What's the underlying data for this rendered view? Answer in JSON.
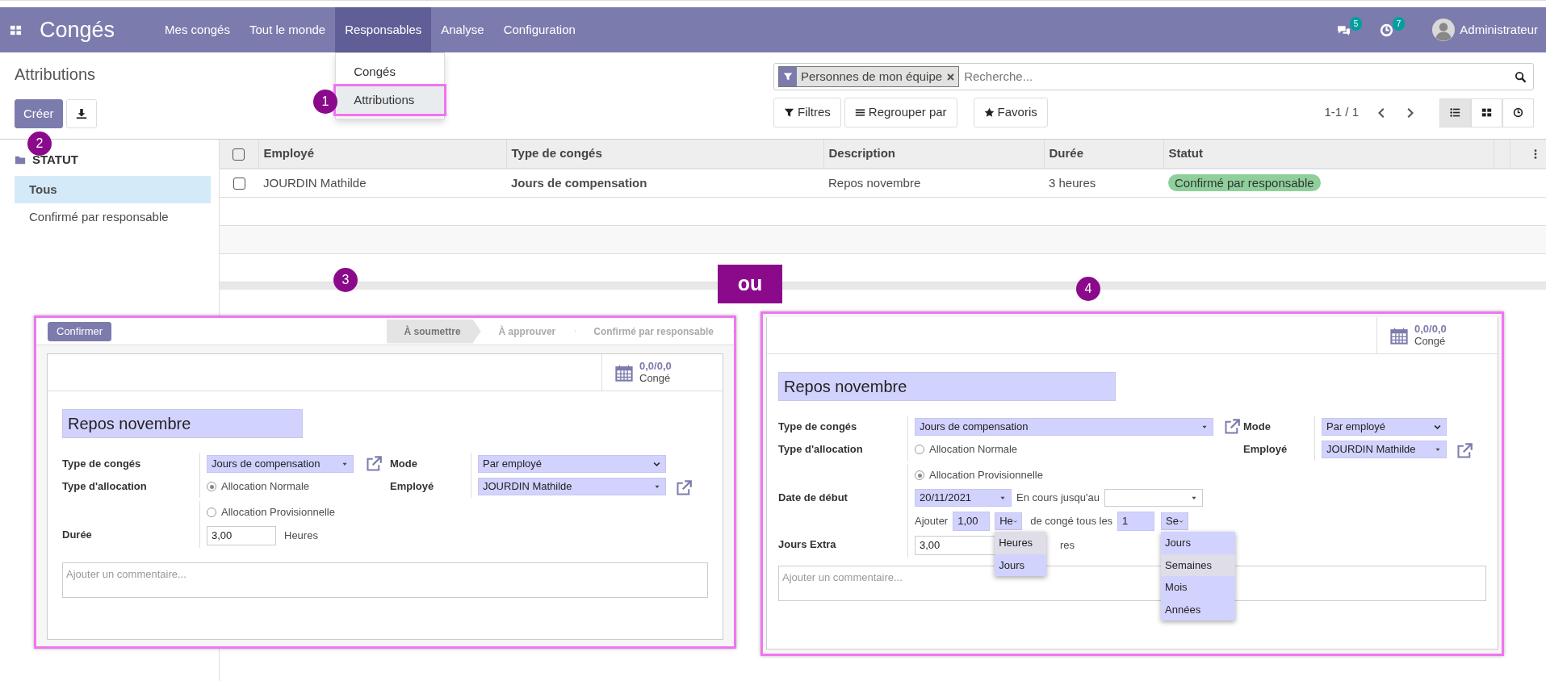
{
  "app": {
    "title": "Congés"
  },
  "menu": [
    {
      "label": "Mes congés",
      "selected": false
    },
    {
      "label": "Tout le monde",
      "selected": false
    },
    {
      "label": "Responsables",
      "selected": true
    },
    {
      "label": "Analyse",
      "selected": false
    },
    {
      "label": "Configuration",
      "selected": false
    }
  ],
  "menu_dropdown": [
    {
      "label": "Congés",
      "selected": false
    },
    {
      "label": "Attributions",
      "selected": true
    }
  ],
  "systray": {
    "messages_count": "5",
    "activities_count": "7",
    "user": "Administrateur"
  },
  "breadcrumb": "Attributions",
  "create_button": "Créer",
  "search": {
    "facet": "Personnes de mon équipe",
    "placeholder": "Recherche..."
  },
  "search_buttons": [
    {
      "kind": "filter",
      "label": "Filtres"
    },
    {
      "kind": "group",
      "label": "Regrouper par"
    },
    {
      "kind": "favorite",
      "label": "Favoris"
    }
  ],
  "pager": "1-1 / 1",
  "views": [
    {
      "kind": "list",
      "selected": true
    },
    {
      "kind": "kanban",
      "selected": false
    },
    {
      "kind": "activity",
      "selected": false
    }
  ],
  "sidebar": {
    "title": "STATUT",
    "items": [
      {
        "label": "Tous",
        "selected": true
      },
      {
        "label": "Confirmé par responsable",
        "selected": false
      }
    ]
  },
  "table": {
    "all_checked": false,
    "columns": [
      "Employé",
      "Type de congés",
      "Description",
      "Durée",
      "Statut"
    ],
    "rows": [
      {
        "checked": false,
        "employee": "JOURDIN Mathilde",
        "leave_type": "Jours de compensation",
        "description": "Repos novembre",
        "duration": "3 heures",
        "status": "Confirmé par responsable"
      }
    ]
  },
  "callouts": [
    "1",
    "2",
    "3",
    "4"
  ],
  "separator": "ou",
  "form_a": {
    "confirm_button": "Confirmer",
    "stages": [
      {
        "label": "À soumettre",
        "selected": true
      },
      {
        "label": "À approuver",
        "selected": false
      },
      {
        "label": "Confirmé par responsable",
        "selected": false
      }
    ],
    "stat": {
      "value": "0,0/0,0",
      "label": "Congé"
    },
    "name": "Repos novembre",
    "leave_type": {
      "label": "Type de congés",
      "value": "Jours de compensation"
    },
    "allocation_type": {
      "label": "Type d'allocation",
      "options": [
        {
          "label": "Allocation Normale",
          "selected": true
        },
        {
          "label": "Allocation Provisionnelle",
          "selected": false
        }
      ]
    },
    "duration": {
      "label": "Durée",
      "value": "3,00",
      "unit": "Heures"
    },
    "mode": {
      "label": "Mode",
      "value": "Par employé"
    },
    "employee": {
      "label": "Employé",
      "value": "JOURDIN Mathilde"
    },
    "comment": {
      "placeholder": "Ajouter un commentaire..."
    }
  },
  "form_b": {
    "stat": {
      "value": "0,0/0,0",
      "label": "Congé"
    },
    "name": "Repos novembre",
    "leave_type": {
      "label": "Type de congés",
      "value": "Jours de compensation"
    },
    "allocation_type": {
      "label": "Type d'allocation",
      "options": [
        {
          "label": "Allocation Normale",
          "selected": false
        },
        {
          "label": "Allocation Provisionnelle",
          "selected": true
        }
      ]
    },
    "start_date": {
      "label": "Date de début",
      "value": "20/11/2021",
      "until_label": "En cours jusqu'au"
    },
    "accrual": {
      "add_label": "Ajouter",
      "amount": "1,00",
      "unit": "He",
      "between": "de congé tous les",
      "every": "1",
      "period": "Se"
    },
    "unit_menu": [
      {
        "label": "Heures",
        "selected": true
      },
      {
        "label": "Jours",
        "selected": false
      }
    ],
    "period_menu": [
      {
        "label": "Jours",
        "selected": false
      },
      {
        "label": "Semaines",
        "selected": true
      },
      {
        "label": "Mois",
        "selected": false
      },
      {
        "label": "Années",
        "selected": false
      }
    ],
    "extra_days": {
      "label": "Jours Extra",
      "value": "3,00",
      "unit_fragment": "res"
    },
    "mode": {
      "label": "Mode",
      "value": "Par employé"
    },
    "employee": {
      "label": "Employé",
      "value": "JOURDIN Mathilde"
    },
    "comment": {
      "placeholder": "Ajouter un commentaire..."
    }
  }
}
